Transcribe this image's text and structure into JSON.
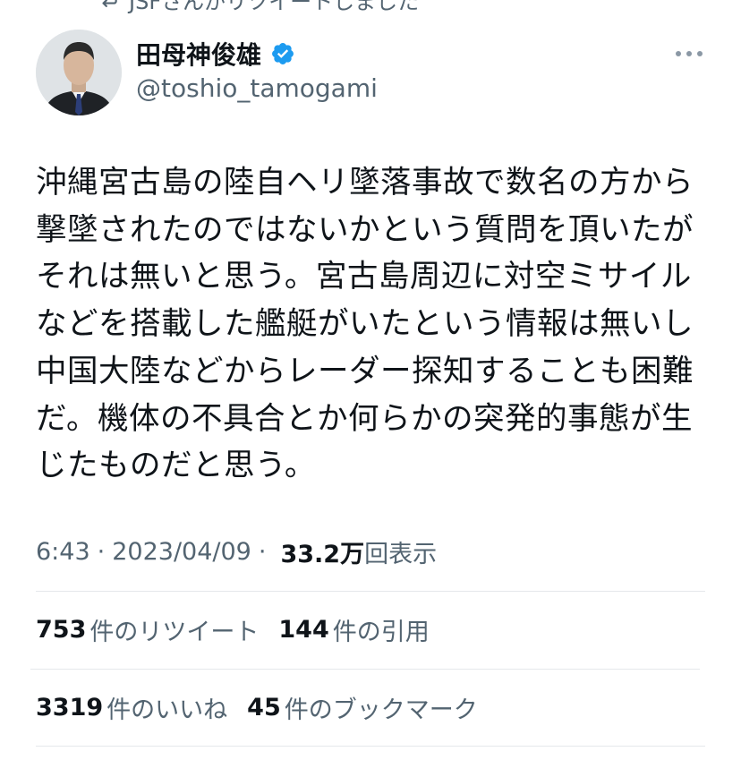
{
  "retweet_banner": {
    "text": "JSFさんがリツイートしました"
  },
  "author": {
    "display_name": "田母神俊雄",
    "handle": "@toshio_tamogami",
    "verified": true
  },
  "tweet": {
    "text": "沖縄宮古島の陸自ヘリ墜落事故で数名の方から撃墜されたのではないかという質問を頂いたがそれは無いと思う。宮古島周辺に対空ミサイルなどを搭載した艦艇がいたという情報は無いし中国大陸などからレーダー探知することも困難だ。機体の不具合とか何らかの突発的事態が生じたものだと思う。",
    "time": "6:43",
    "date": "2023/04/09",
    "views_count": "33.2万",
    "views_label": "回表示"
  },
  "stats": {
    "retweets_count": "753",
    "retweets_label": "件のリツイート",
    "quotes_count": "144",
    "quotes_label": "件の引用",
    "likes_count": "3319",
    "likes_label": "件のいいね",
    "bookmarks_count": "45",
    "bookmarks_label": "件のブックマーク"
  },
  "colors": {
    "text_primary": "#0f1419",
    "text_secondary": "#536471",
    "verified_blue": "#1d9bf0",
    "divider": "#e5e8eb"
  },
  "icons": [
    "retweet-icon",
    "verified-badge-icon",
    "more-icon"
  ]
}
